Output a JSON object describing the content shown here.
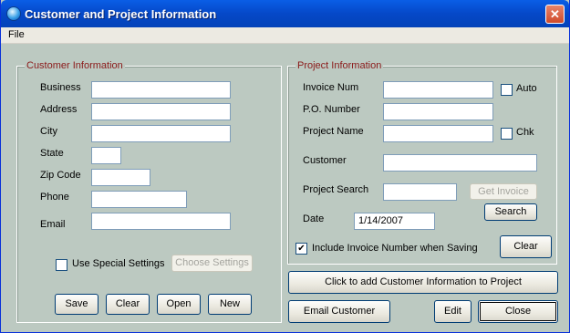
{
  "window": {
    "title": "Customer and Project Information",
    "close_glyph": "✕",
    "icon": "globe-icon"
  },
  "menu": {
    "file": "File"
  },
  "customer": {
    "legend": "Customer Information",
    "fields": [
      {
        "label": "Business",
        "value": ""
      },
      {
        "label": "Address",
        "value": ""
      },
      {
        "label": "City",
        "value": ""
      },
      {
        "label": "State",
        "value": ""
      },
      {
        "label": "Zip Code",
        "value": ""
      },
      {
        "label": "Phone",
        "value": ""
      },
      {
        "label": "Email",
        "value": ""
      }
    ],
    "special_settings": {
      "label": "Use Special Settings",
      "checked": false
    },
    "choose_settings": "Choose Settings",
    "buttons": {
      "save": "Save",
      "clear": "Clear",
      "open": "Open",
      "new": "New"
    }
  },
  "project": {
    "legend": "Project Information",
    "invoice_num": {
      "label": "Invoice Num",
      "value": ""
    },
    "auto": {
      "label": "Auto",
      "checked": false
    },
    "po_number": {
      "label": "P.O. Number",
      "value": ""
    },
    "project_name": {
      "label": "Project Name",
      "value": ""
    },
    "chk": {
      "label": "Chk",
      "checked": false
    },
    "customer": {
      "label": "Customer",
      "value": ""
    },
    "project_search": {
      "label": "Project Search",
      "value": ""
    },
    "get_invoice": "Get Invoice",
    "search": "Search",
    "date": {
      "label": "Date",
      "value": "1/14/2007"
    },
    "include_invoice": {
      "label": "Include Invoice Number when Saving",
      "checked": true,
      "check_glyph": "✔"
    },
    "clear": "Clear"
  },
  "bottom": {
    "add_customer": "Click to add Customer Information to Project",
    "email_customer": "Email Customer",
    "edit": "Edit",
    "close": "Close"
  }
}
